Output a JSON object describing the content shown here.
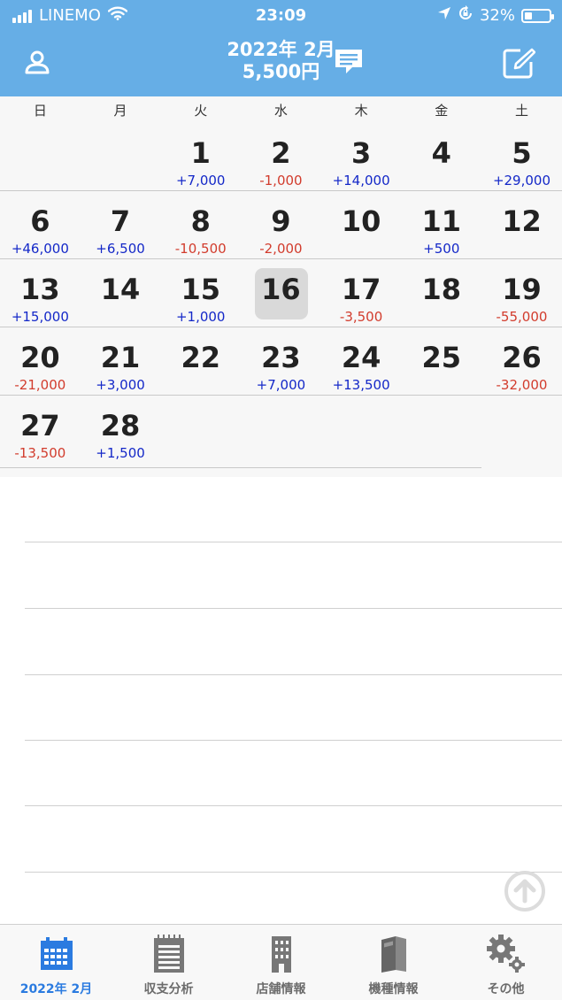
{
  "status_bar": {
    "carrier": "LINEMO",
    "time": "23:09",
    "battery_percent": "32%",
    "battery_level": 0.32,
    "icons": [
      "signal-icon",
      "wifi-icon",
      "location-arrow-icon",
      "rotation-lock-icon",
      "battery-icon"
    ]
  },
  "header": {
    "month": "2022年 2月",
    "total": "5,500円",
    "profile_icon": "person-icon",
    "message_icon": "message-icon",
    "edit_icon": "edit-icon",
    "bg_color": "#66aee6"
  },
  "weekdays": [
    "日",
    "月",
    "火",
    "水",
    "木",
    "金",
    "土"
  ],
  "calendar": {
    "today": "16",
    "weeks": [
      [
        {
          "day": "",
          "amount": ""
        },
        {
          "day": "",
          "amount": ""
        },
        {
          "day": "1",
          "amount": "+7,000"
        },
        {
          "day": "2",
          "amount": "-1,000"
        },
        {
          "day": "3",
          "amount": "+14,000"
        },
        {
          "day": "4",
          "amount": ""
        },
        {
          "day": "5",
          "amount": "+29,000"
        }
      ],
      [
        {
          "day": "6",
          "amount": "+46,000"
        },
        {
          "day": "7",
          "amount": "+6,500"
        },
        {
          "day": "8",
          "amount": "-10,500"
        },
        {
          "day": "9",
          "amount": "-2,000"
        },
        {
          "day": "10",
          "amount": ""
        },
        {
          "day": "11",
          "amount": "+500"
        },
        {
          "day": "12",
          "amount": ""
        }
      ],
      [
        {
          "day": "13",
          "amount": "+15,000"
        },
        {
          "day": "14",
          "amount": ""
        },
        {
          "day": "15",
          "amount": "+1,000"
        },
        {
          "day": "16",
          "amount": ""
        },
        {
          "day": "17",
          "amount": "-3,500"
        },
        {
          "day": "18",
          "amount": ""
        },
        {
          "day": "19",
          "amount": "-55,000"
        }
      ],
      [
        {
          "day": "20",
          "amount": "-21,000"
        },
        {
          "day": "21",
          "amount": "+3,000"
        },
        {
          "day": "22",
          "amount": ""
        },
        {
          "day": "23",
          "amount": "+7,000"
        },
        {
          "day": "24",
          "amount": "+13,500"
        },
        {
          "day": "25",
          "amount": ""
        },
        {
          "day": "26",
          "amount": "-32,000"
        }
      ],
      [
        {
          "day": "27",
          "amount": "-13,500"
        },
        {
          "day": "28",
          "amount": "+1,500"
        },
        {
          "day": "",
          "amount": ""
        },
        {
          "day": "",
          "amount": ""
        },
        {
          "day": "",
          "amount": ""
        },
        {
          "day": "",
          "amount": ""
        },
        {
          "day": "",
          "amount": ""
        }
      ]
    ],
    "colors": {
      "positive": "#1428c8",
      "negative": "#d23c2d"
    }
  },
  "notes": {
    "scroll_top_icon": "arrow-up-circle-icon"
  },
  "tabbar": {
    "tabs": [
      {
        "label": "2022年 2月",
        "icon": "calendar-icon",
        "active": true
      },
      {
        "label": "収支分析",
        "icon": "notepad-icon",
        "active": false
      },
      {
        "label": "店舗情報",
        "icon": "building-icon",
        "active": false
      },
      {
        "label": "機種情報",
        "icon": "book-icon",
        "active": false
      },
      {
        "label": "その他",
        "icon": "gear-icon",
        "active": false
      }
    ],
    "active_color": "#2b7be0"
  }
}
